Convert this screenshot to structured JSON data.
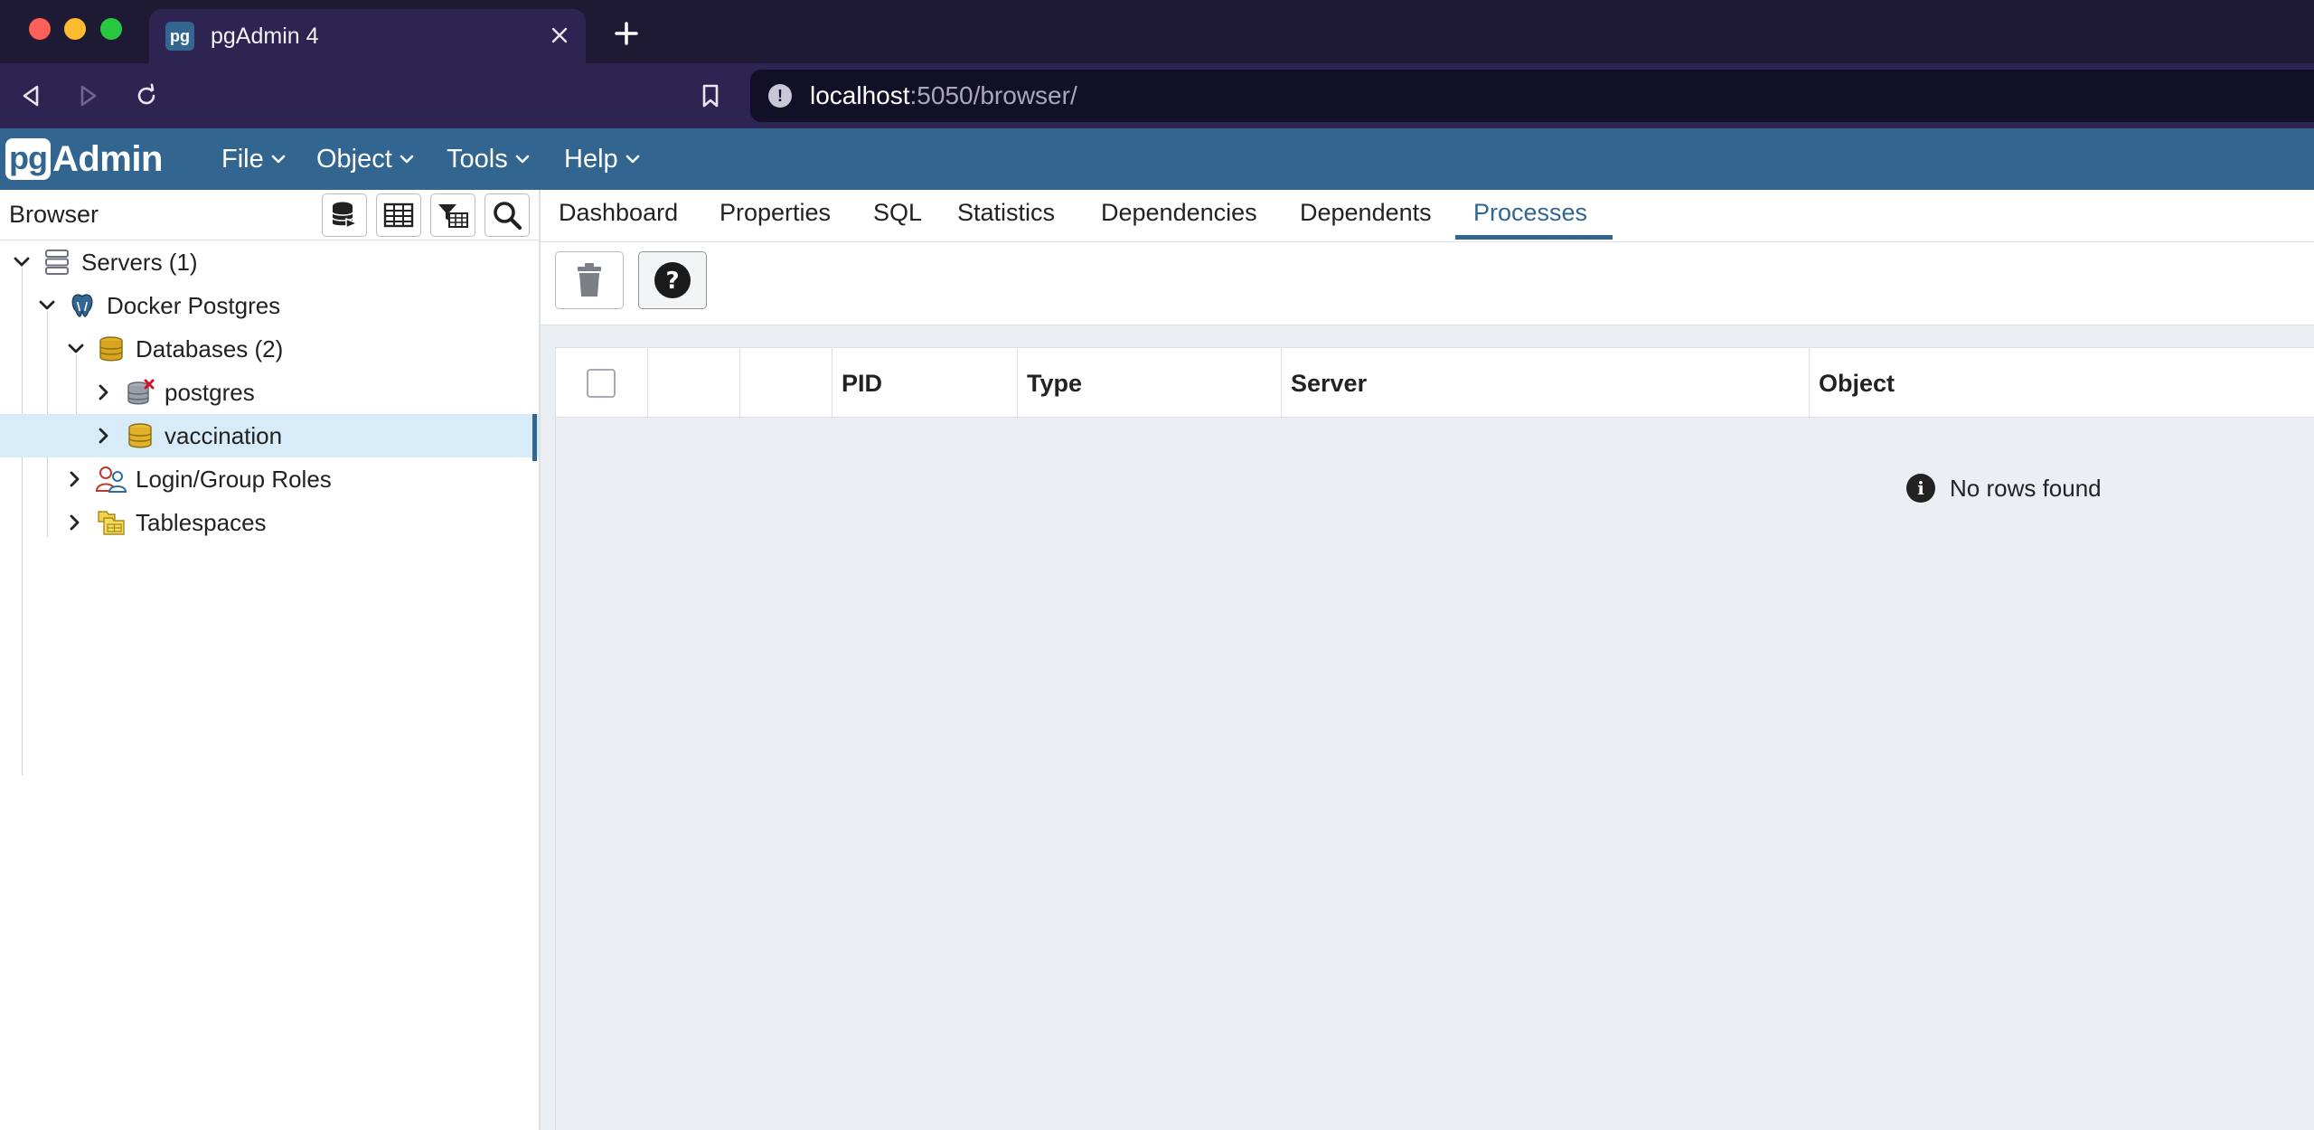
{
  "browser": {
    "tab_title": "pgAdmin 4",
    "url_host": "localhost",
    "url_path": ":5050/browser/"
  },
  "app": {
    "logo_pg": "pg",
    "logo_admin": "Admin",
    "menu": [
      "File",
      "Object",
      "Tools",
      "Help"
    ]
  },
  "left_panel": {
    "title": "Browser",
    "toolbar_icons": [
      "query-tool-icon",
      "view-data-icon",
      "filtered-rows-icon",
      "search-objects-icon"
    ],
    "tree": [
      {
        "label": "Servers (1)",
        "depth": 0,
        "expanded": true,
        "icon": "servers-icon"
      },
      {
        "label": "Docker Postgres",
        "depth": 1,
        "expanded": true,
        "icon": "postgres-elephant-icon"
      },
      {
        "label": "Databases (2)",
        "depth": 2,
        "expanded": true,
        "icon": "databases-icon"
      },
      {
        "label": "postgres",
        "depth": 3,
        "expanded": false,
        "icon": "database-disconnected-icon"
      },
      {
        "label": "vaccination",
        "depth": 3,
        "expanded": false,
        "icon": "database-icon",
        "selected": true
      },
      {
        "label": "Login/Group Roles",
        "depth": 2,
        "expanded": false,
        "icon": "roles-icon"
      },
      {
        "label": "Tablespaces",
        "depth": 2,
        "expanded": false,
        "icon": "tablespaces-icon"
      }
    ]
  },
  "right_panel": {
    "tabs": [
      "Dashboard",
      "Properties",
      "SQL",
      "Statistics",
      "Dependencies",
      "Dependents",
      "Processes"
    ],
    "active_tab": "Processes",
    "columns": [
      "",
      "",
      "",
      "PID",
      "Type",
      "Server",
      "Object"
    ],
    "empty_message": "No rows found"
  },
  "colors": {
    "header": "#326690",
    "browser_chrome": "#2e2452",
    "selected_row": "#d7ecf8",
    "grid_background": "#ebeef3"
  }
}
